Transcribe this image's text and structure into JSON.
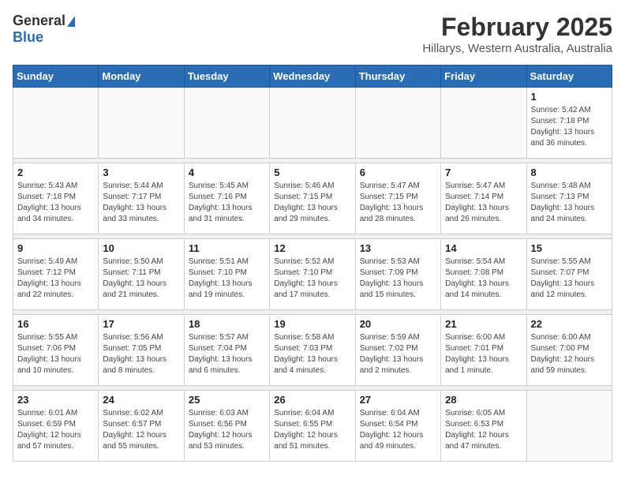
{
  "header": {
    "logo_general": "General",
    "logo_blue": "Blue",
    "month_title": "February 2025",
    "location": "Hillarys, Western Australia, Australia"
  },
  "weekdays": [
    "Sunday",
    "Monday",
    "Tuesday",
    "Wednesday",
    "Thursday",
    "Friday",
    "Saturday"
  ],
  "weeks": [
    [
      {
        "day": "",
        "info": ""
      },
      {
        "day": "",
        "info": ""
      },
      {
        "day": "",
        "info": ""
      },
      {
        "day": "",
        "info": ""
      },
      {
        "day": "",
        "info": ""
      },
      {
        "day": "",
        "info": ""
      },
      {
        "day": "1",
        "info": "Sunrise: 5:42 AM\nSunset: 7:18 PM\nDaylight: 13 hours\nand 36 minutes."
      }
    ],
    [
      {
        "day": "2",
        "info": "Sunrise: 5:43 AM\nSunset: 7:18 PM\nDaylight: 13 hours\nand 34 minutes."
      },
      {
        "day": "3",
        "info": "Sunrise: 5:44 AM\nSunset: 7:17 PM\nDaylight: 13 hours\nand 33 minutes."
      },
      {
        "day": "4",
        "info": "Sunrise: 5:45 AM\nSunset: 7:16 PM\nDaylight: 13 hours\nand 31 minutes."
      },
      {
        "day": "5",
        "info": "Sunrise: 5:46 AM\nSunset: 7:15 PM\nDaylight: 13 hours\nand 29 minutes."
      },
      {
        "day": "6",
        "info": "Sunrise: 5:47 AM\nSunset: 7:15 PM\nDaylight: 13 hours\nand 28 minutes."
      },
      {
        "day": "7",
        "info": "Sunrise: 5:47 AM\nSunset: 7:14 PM\nDaylight: 13 hours\nand 26 minutes."
      },
      {
        "day": "8",
        "info": "Sunrise: 5:48 AM\nSunset: 7:13 PM\nDaylight: 13 hours\nand 24 minutes."
      }
    ],
    [
      {
        "day": "9",
        "info": "Sunrise: 5:49 AM\nSunset: 7:12 PM\nDaylight: 13 hours\nand 22 minutes."
      },
      {
        "day": "10",
        "info": "Sunrise: 5:50 AM\nSunset: 7:11 PM\nDaylight: 13 hours\nand 21 minutes."
      },
      {
        "day": "11",
        "info": "Sunrise: 5:51 AM\nSunset: 7:10 PM\nDaylight: 13 hours\nand 19 minutes."
      },
      {
        "day": "12",
        "info": "Sunrise: 5:52 AM\nSunset: 7:10 PM\nDaylight: 13 hours\nand 17 minutes."
      },
      {
        "day": "13",
        "info": "Sunrise: 5:53 AM\nSunset: 7:09 PM\nDaylight: 13 hours\nand 15 minutes."
      },
      {
        "day": "14",
        "info": "Sunrise: 5:54 AM\nSunset: 7:08 PM\nDaylight: 13 hours\nand 14 minutes."
      },
      {
        "day": "15",
        "info": "Sunrise: 5:55 AM\nSunset: 7:07 PM\nDaylight: 13 hours\nand 12 minutes."
      }
    ],
    [
      {
        "day": "16",
        "info": "Sunrise: 5:55 AM\nSunset: 7:06 PM\nDaylight: 13 hours\nand 10 minutes."
      },
      {
        "day": "17",
        "info": "Sunrise: 5:56 AM\nSunset: 7:05 PM\nDaylight: 13 hours\nand 8 minutes."
      },
      {
        "day": "18",
        "info": "Sunrise: 5:57 AM\nSunset: 7:04 PM\nDaylight: 13 hours\nand 6 minutes."
      },
      {
        "day": "19",
        "info": "Sunrise: 5:58 AM\nSunset: 7:03 PM\nDaylight: 13 hours\nand 4 minutes."
      },
      {
        "day": "20",
        "info": "Sunrise: 5:59 AM\nSunset: 7:02 PM\nDaylight: 13 hours\nand 2 minutes."
      },
      {
        "day": "21",
        "info": "Sunrise: 6:00 AM\nSunset: 7:01 PM\nDaylight: 13 hours\nand 1 minute."
      },
      {
        "day": "22",
        "info": "Sunrise: 6:00 AM\nSunset: 7:00 PM\nDaylight: 12 hours\nand 59 minutes."
      }
    ],
    [
      {
        "day": "23",
        "info": "Sunrise: 6:01 AM\nSunset: 6:59 PM\nDaylight: 12 hours\nand 57 minutes."
      },
      {
        "day": "24",
        "info": "Sunrise: 6:02 AM\nSunset: 6:57 PM\nDaylight: 12 hours\nand 55 minutes."
      },
      {
        "day": "25",
        "info": "Sunrise: 6:03 AM\nSunset: 6:56 PM\nDaylight: 12 hours\nand 53 minutes."
      },
      {
        "day": "26",
        "info": "Sunrise: 6:04 AM\nSunset: 6:55 PM\nDaylight: 12 hours\nand 51 minutes."
      },
      {
        "day": "27",
        "info": "Sunrise: 6:04 AM\nSunset: 6:54 PM\nDaylight: 12 hours\nand 49 minutes."
      },
      {
        "day": "28",
        "info": "Sunrise: 6:05 AM\nSunset: 6:53 PM\nDaylight: 12 hours\nand 47 minutes."
      },
      {
        "day": "",
        "info": ""
      }
    ]
  ]
}
